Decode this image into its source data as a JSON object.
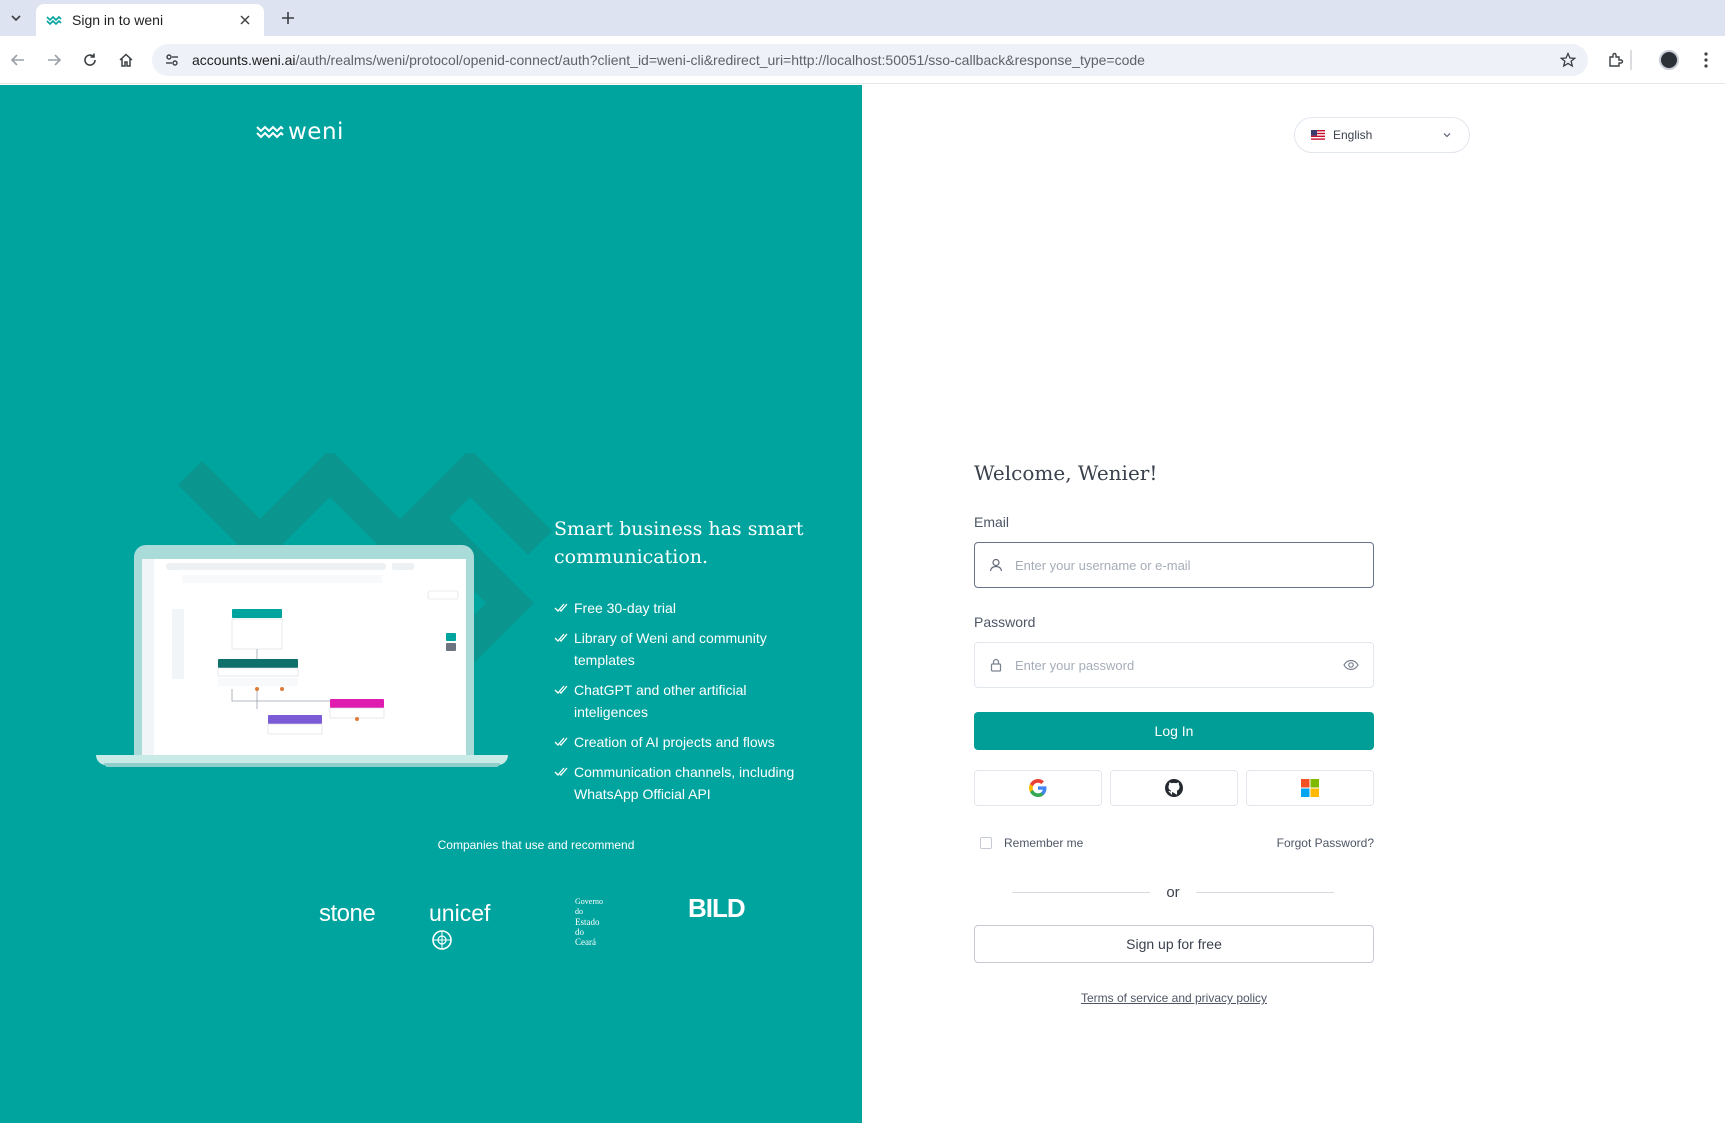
{
  "browser": {
    "tab_title": "Sign in to weni",
    "url_host": "accounts.weni.ai",
    "url_path": "/auth/realms/weni/protocol/openid-connect/auth?client_id=weni-cli&redirect_uri=http://localhost:50051/sso-callback&response_type=code"
  },
  "brand": {
    "logo_text": "weni",
    "primary_color": "#00a49f",
    "button_color": "#009e96"
  },
  "promo": {
    "title": "Smart business has smart communication.",
    "features": [
      "Free 30-day trial",
      "Library of Weni and community templates",
      "ChatGPT and other artificial inteligences",
      "Creation of AI projects and flows",
      "Communication channels, including WhatsApp Official API"
    ],
    "companies_label": "Companies that use and recommend",
    "companies": {
      "stone": "stone",
      "unicef": "unicef",
      "gov_line1": "Governo do",
      "gov_line2": "Estado do Ceará",
      "bild": "BILD"
    }
  },
  "language": {
    "selected": "English"
  },
  "login": {
    "welcome": "Welcome, Wenier!",
    "email_label": "Email",
    "email_placeholder": "Enter your username or e-mail",
    "password_label": "Password",
    "password_placeholder": "Enter your password",
    "login_button": "Log In",
    "remember_label": "Remember me",
    "forgot_link": "Forgot Password?",
    "or_text": "or",
    "signup_button": "Sign up for free",
    "terms_link": "Terms of service and privacy policy"
  }
}
